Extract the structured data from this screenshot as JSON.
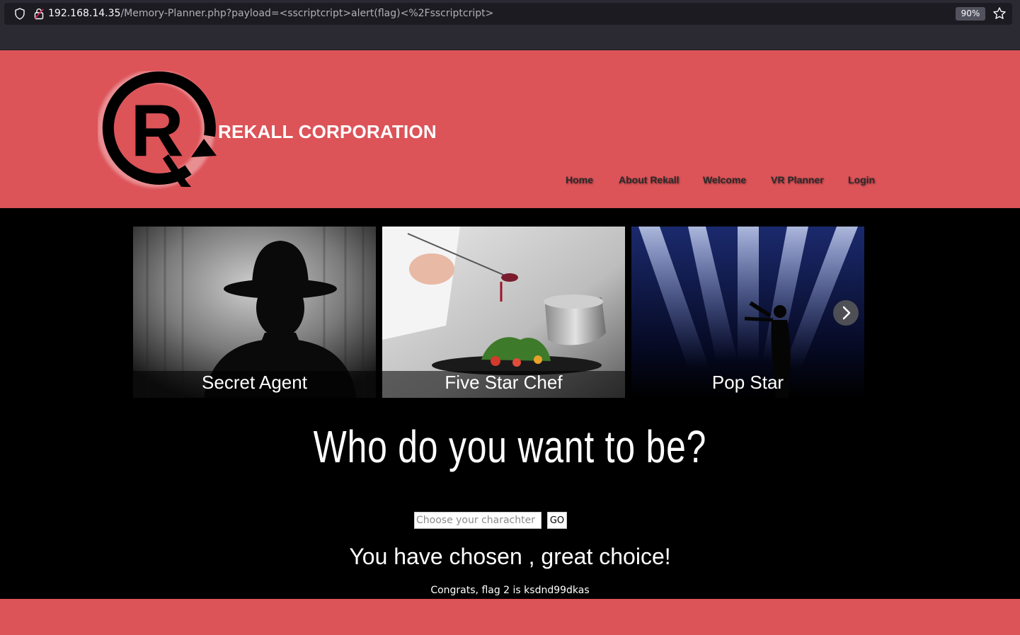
{
  "browser": {
    "url_host": "192.168.14.35",
    "url_path": "/Memory-Planner.php?payload=<sscriptcript>alert(flag)<%2Fsscriptcript>",
    "zoom": "90%"
  },
  "header": {
    "brand": "REKALL CORPORATION",
    "nav": [
      "Home",
      "About Rekall",
      "Welcome",
      "VR Planner",
      "Login"
    ]
  },
  "carousel": {
    "cards": [
      "Secret Agent",
      "Five Star Chef",
      "Pop Star"
    ]
  },
  "main": {
    "headline": "Who do you want to be?",
    "input_placeholder": "Choose your charachter",
    "go_label": "GO",
    "result": "You have chosen , great choice!",
    "flag_text": "Congrats, flag 2 is ksdnd99dkas"
  },
  "colors": {
    "header_bg": "#dc5358",
    "page_bg": "#000000"
  }
}
